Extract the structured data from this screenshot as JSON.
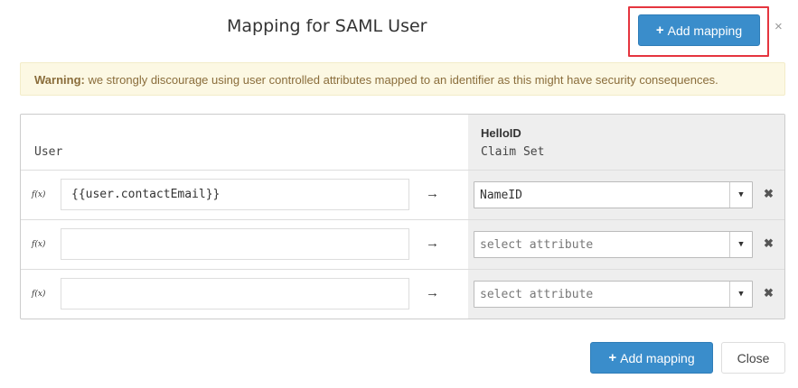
{
  "dialog": {
    "title": "Mapping for SAML User",
    "add_mapping_label": "Add mapping",
    "close_x": "×",
    "close_label": "Close"
  },
  "warning": {
    "prefix": "Warning:",
    "text": " we strongly discourage using user controlled attributes mapped to an identifier as this might have security consequences."
  },
  "table": {
    "left_header": "User",
    "right_header_title": "HelloID",
    "right_header_subtitle": "Claim Set",
    "fx_label": "f(x)",
    "arrow": "→",
    "rows": [
      {
        "value": "{{user.contactEmail}}",
        "attribute": "NameID",
        "placeholder": false
      },
      {
        "value": "",
        "attribute": "select attribute",
        "placeholder": true
      },
      {
        "value": "",
        "attribute": "select attribute",
        "placeholder": true
      }
    ]
  },
  "colors": {
    "primary": "#3a8dcb",
    "highlight": "#e5353f",
    "warning_bg": "#fcf8e3",
    "warning_text": "#8a6d3b"
  },
  "icons": {
    "add": "plus-icon",
    "remove": "remove-icon",
    "dropdown": "caret-down-icon",
    "mapping": "arrow-right-icon"
  }
}
